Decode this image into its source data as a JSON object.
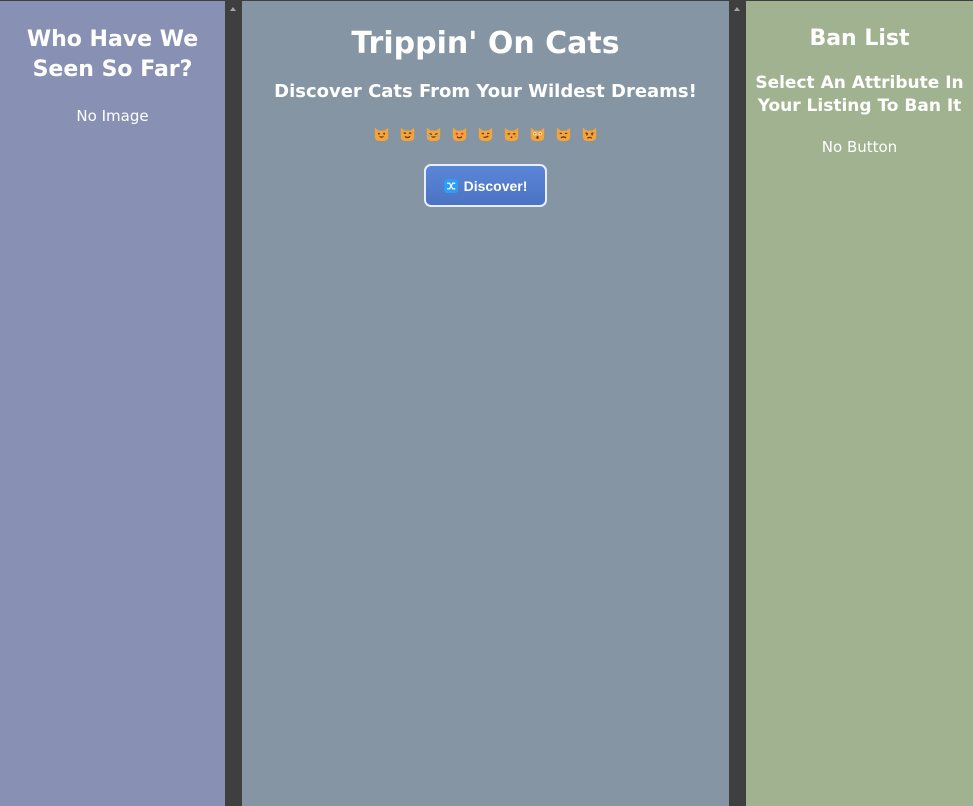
{
  "left_panel": {
    "title": "Who Have We Seen So Far?",
    "empty_text": "No Image"
  },
  "main_panel": {
    "title": "Trippin' On Cats",
    "subtitle": "Discover Cats From Your Wildest Dreams!",
    "emoji_row": [
      "grinning-cat-icon",
      "smiling-cat-icon",
      "joy-cat-icon",
      "heart-eyes-cat-icon",
      "smirk-cat-icon",
      "kissing-cat-icon",
      "weary-cat-icon",
      "crying-cat-icon",
      "pouting-cat-icon"
    ],
    "discover_button": {
      "label": "Discover!",
      "icon": "shuffle-icon"
    }
  },
  "right_panel": {
    "title": "Ban List",
    "subtitle": "Select An Attribute In Your Listing To Ban It",
    "empty_text": "No Button"
  },
  "colors": {
    "left_panel": "#8891b3",
    "main_panel": "#8595a3",
    "right_panel": "#a0b290",
    "scrollbar": "#3f3f3f",
    "button": "#5a86d8"
  }
}
